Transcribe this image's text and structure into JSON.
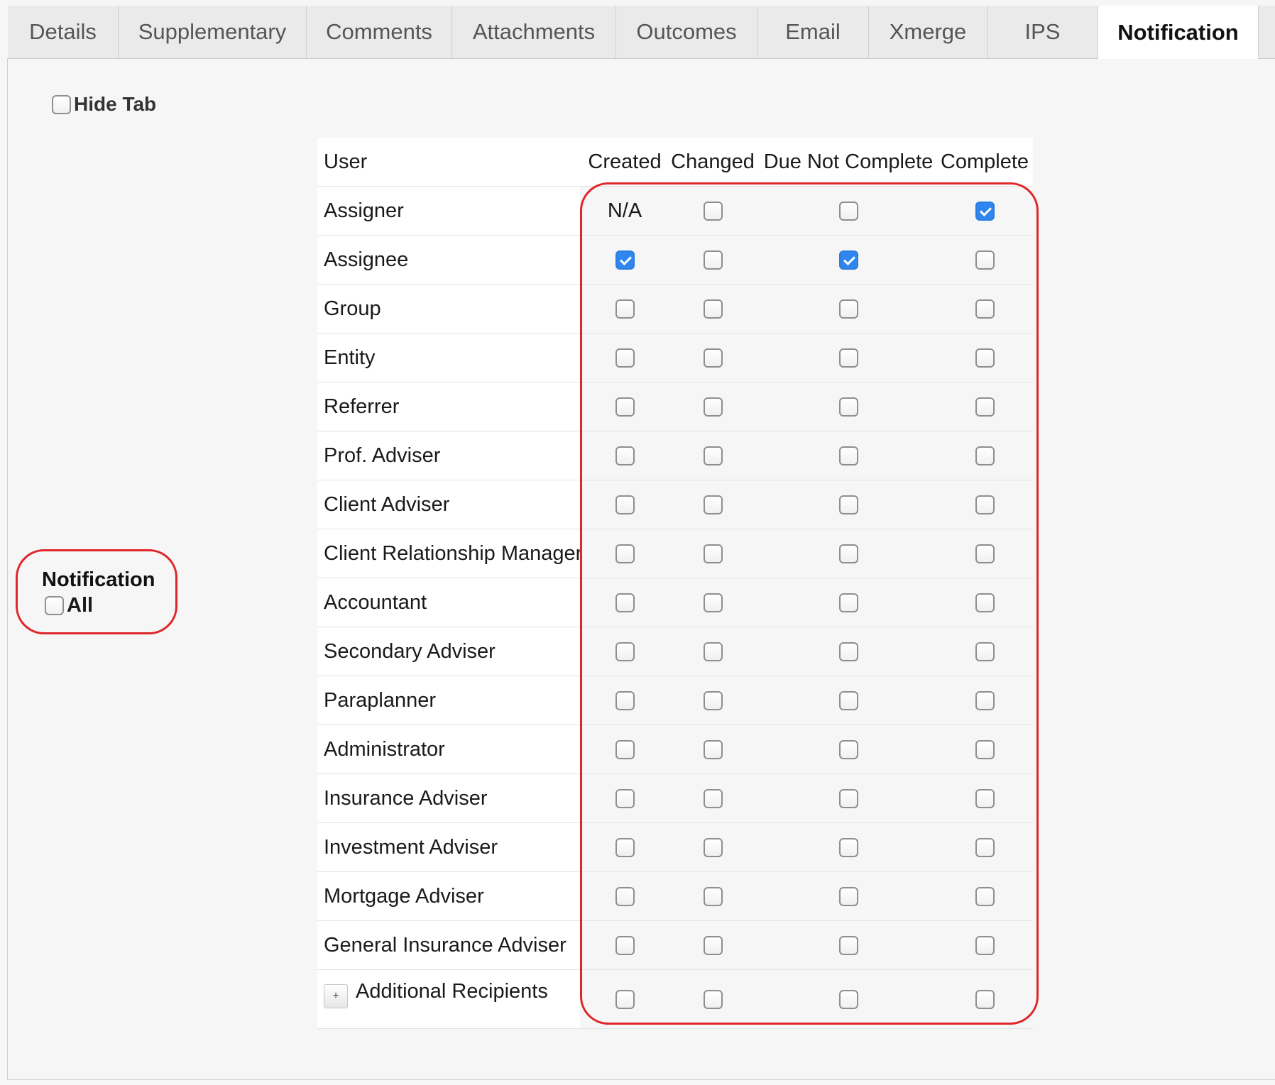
{
  "tabs": [
    {
      "label": "Details",
      "width": 156
    },
    {
      "label": "Supplementary",
      "width": 265
    },
    {
      "label": "Comments",
      "width": 205
    },
    {
      "label": "Attachments",
      "width": 231
    },
    {
      "label": "Outcomes",
      "width": 199
    },
    {
      "label": "Email",
      "width": 157
    },
    {
      "label": "Xmerge",
      "width": 167
    },
    {
      "label": "IPS",
      "width": 156
    },
    {
      "label": "Notification",
      "width": 226,
      "active": true
    }
  ],
  "hide_tab": {
    "label": "Hide Tab",
    "checked": false
  },
  "notification_all": {
    "title": "Notification",
    "label": "All",
    "checked": false
  },
  "grid": {
    "headers": {
      "user": "User",
      "created": "Created",
      "changed": "Changed",
      "due_not_complete": "Due Not Complete",
      "complete": "Complete"
    },
    "rows": [
      {
        "user": "Assigner",
        "created": "N/A",
        "changed": false,
        "due_not_complete": false,
        "complete": true
      },
      {
        "user": "Assignee",
        "created": true,
        "changed": false,
        "due_not_complete": true,
        "complete": false
      },
      {
        "user": "Group",
        "created": false,
        "changed": false,
        "due_not_complete": false,
        "complete": false
      },
      {
        "user": "Entity",
        "created": false,
        "changed": false,
        "due_not_complete": false,
        "complete": false
      },
      {
        "user": "Referrer",
        "created": false,
        "changed": false,
        "due_not_complete": false,
        "complete": false
      },
      {
        "user": "Prof. Adviser",
        "created": false,
        "changed": false,
        "due_not_complete": false,
        "complete": false
      },
      {
        "user": "Client Adviser",
        "created": false,
        "changed": false,
        "due_not_complete": false,
        "complete": false
      },
      {
        "user": "Client Relationship Manager",
        "created": false,
        "changed": false,
        "due_not_complete": false,
        "complete": false
      },
      {
        "user": "Accountant",
        "created": false,
        "changed": false,
        "due_not_complete": false,
        "complete": false
      },
      {
        "user": "Secondary Adviser",
        "created": false,
        "changed": false,
        "due_not_complete": false,
        "complete": false
      },
      {
        "user": "Paraplanner",
        "created": false,
        "changed": false,
        "due_not_complete": false,
        "complete": false
      },
      {
        "user": "Administrator",
        "created": false,
        "changed": false,
        "due_not_complete": false,
        "complete": false
      },
      {
        "user": "Insurance Adviser",
        "created": false,
        "changed": false,
        "due_not_complete": false,
        "complete": false
      },
      {
        "user": "Investment Adviser",
        "created": false,
        "changed": false,
        "due_not_complete": false,
        "complete": false
      },
      {
        "user": "Mortgage Adviser",
        "created": false,
        "changed": false,
        "due_not_complete": false,
        "complete": false
      },
      {
        "user": "General Insurance Adviser",
        "created": false,
        "changed": false,
        "due_not_complete": false,
        "complete": false
      }
    ],
    "additional": {
      "user": "Additional Recipients",
      "plus_icon": "plus-icon",
      "created": false,
      "changed": false,
      "due_not_complete": false,
      "complete": false
    }
  },
  "colors": {
    "highlight": "#e0262a",
    "checked": "#2e86ee"
  }
}
